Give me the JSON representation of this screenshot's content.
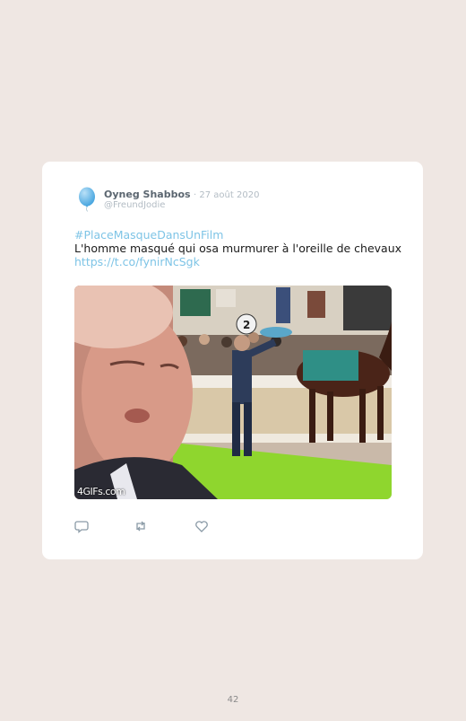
{
  "tweet": {
    "author_name": "Oyneg Shabbos",
    "date": "· 27 août 2020",
    "handle": "@FreundJodie",
    "hashtag": "#PlaceMasqueDansUnFilm",
    "text": "L'homme masqué qui osa murmurer à l'oreille de chevaux",
    "link": "https://t.co/fynirNcSgk",
    "media": {
      "watermark": "4GIFs.com",
      "sign_number": "2"
    },
    "actions": [
      {
        "icon": "reply-icon"
      },
      {
        "icon": "retweet-icon"
      },
      {
        "icon": "like-icon"
      }
    ]
  },
  "colors": {
    "page_background": "#efe7e3",
    "card_background": "#ffffff",
    "link": "#7ec4e6",
    "avatar": "#6fb8e8"
  },
  "page_number": "42"
}
